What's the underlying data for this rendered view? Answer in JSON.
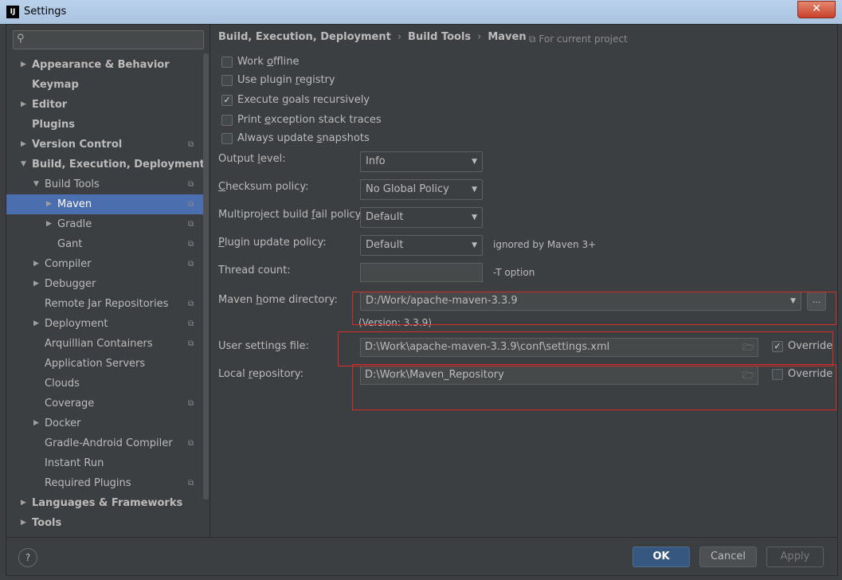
{
  "window": {
    "title": "Settings",
    "app_icon": "IJ",
    "close_glyph": "✕"
  },
  "sidebar": {
    "search_placeholder": "",
    "items": [
      {
        "label": "Appearance & Behavior",
        "level": 0,
        "arrow": "▶",
        "bold": true
      },
      {
        "label": "Keymap",
        "level": 0,
        "arrow": "",
        "bold": true
      },
      {
        "label": "Editor",
        "level": 0,
        "arrow": "▶",
        "bold": true
      },
      {
        "label": "Plugins",
        "level": 0,
        "arrow": "",
        "bold": true
      },
      {
        "label": "Version Control",
        "level": 0,
        "arrow": "▶",
        "bold": true,
        "project": true
      },
      {
        "label": "Build, Execution, Deployment",
        "level": 0,
        "arrow": "▼",
        "bold": true
      },
      {
        "label": "Build Tools",
        "level": 1,
        "arrow": "▼",
        "project": true
      },
      {
        "label": "Maven",
        "level": 2,
        "arrow": "▶",
        "project": true,
        "selected": true
      },
      {
        "label": "Gradle",
        "level": 2,
        "arrow": "▶",
        "project": true
      },
      {
        "label": "Gant",
        "level": 2,
        "arrow": "",
        "project": true
      },
      {
        "label": "Compiler",
        "level": 1,
        "arrow": "▶",
        "project": true
      },
      {
        "label": "Debugger",
        "level": 1,
        "arrow": "▶"
      },
      {
        "label": "Remote Jar Repositories",
        "level": 1,
        "arrow": "",
        "project": true
      },
      {
        "label": "Deployment",
        "level": 1,
        "arrow": "▶",
        "project": true
      },
      {
        "label": "Arquillian Containers",
        "level": 1,
        "arrow": "",
        "project": true
      },
      {
        "label": "Application Servers",
        "level": 1,
        "arrow": ""
      },
      {
        "label": "Clouds",
        "level": 1,
        "arrow": ""
      },
      {
        "label": "Coverage",
        "level": 1,
        "arrow": "",
        "project": true
      },
      {
        "label": "Docker",
        "level": 1,
        "arrow": "▶"
      },
      {
        "label": "Gradle-Android Compiler",
        "level": 1,
        "arrow": "",
        "project": true
      },
      {
        "label": "Instant Run",
        "level": 1,
        "arrow": ""
      },
      {
        "label": "Required Plugins",
        "level": 1,
        "arrow": "",
        "project": true
      },
      {
        "label": "Languages & Frameworks",
        "level": 0,
        "arrow": "▶",
        "bold": true
      },
      {
        "label": "Tools",
        "level": 0,
        "arrow": "▶",
        "bold": true
      }
    ],
    "project_icon": "⧉"
  },
  "breadcrumb": {
    "part1": "Build, Execution, Deployment",
    "part2": "Build Tools",
    "part3": "Maven",
    "separator": "›"
  },
  "for_project": "⧉ For current project",
  "options": {
    "work_offline": {
      "pre": "Work ",
      "u": "o",
      "post": "ffline",
      "checked": false
    },
    "use_plugin_registry": {
      "pre": "Use plugin ",
      "u": "r",
      "post": "egistry",
      "checked": false
    },
    "execute_goals": {
      "pre": "Execute ",
      "u": "g",
      "post": "oals recursively",
      "checked": true
    },
    "print_exception": {
      "pre": "Print ",
      "u": "e",
      "post": "xception stack traces",
      "checked": false
    },
    "always_update": {
      "pre": "Always update ",
      "u": "s",
      "post": "napshots",
      "checked": false
    }
  },
  "form": {
    "output_level": {
      "pre": "Output ",
      "u": "l",
      "post": "evel:",
      "value": "Info"
    },
    "checksum_policy": {
      "pre": "",
      "u": "C",
      "post": "hecksum policy:",
      "value": "No Global Policy"
    },
    "multiproject_fail": {
      "pre": "Multiproject build ",
      "u": "f",
      "post": "ail policy:",
      "value": "Default"
    },
    "plugin_update": {
      "pre": "",
      "u": "P",
      "post": "lugin update policy:",
      "value": "Default",
      "hint": "ignored by Maven 3+"
    },
    "thread_count": {
      "label": "Thread count:",
      "value": "",
      "hint": "-T option"
    },
    "maven_home": {
      "pre": "Maven ",
      "u": "h",
      "post": "ome directory:",
      "value": "D:/Work/apache-maven-3.3.9",
      "version": "(Version: 3.3.9)",
      "browse": "..."
    },
    "user_settings": {
      "label": "User settings file:",
      "value": "D:\\Work\\apache-maven-3.3.9\\conf\\settings.xml",
      "override_label": "Override",
      "override": true
    },
    "local_repo": {
      "pre": "Local ",
      "u": "r",
      "post": "epository:",
      "value": "D:\\Work\\Maven_Repository",
      "override_label": "Override",
      "override": false
    }
  },
  "buttons": {
    "help": "?",
    "ok": "OK",
    "cancel": "Cancel",
    "apply": "Apply"
  },
  "glyphs": {
    "check": "✓",
    "caret": "▼",
    "folder": "🗁",
    "magnifier": "⚲"
  },
  "colors": {
    "selection": "#4b6eaf",
    "background": "#3c3f41",
    "highlight_box": "#d82c2c",
    "ok_button": "#365880"
  }
}
